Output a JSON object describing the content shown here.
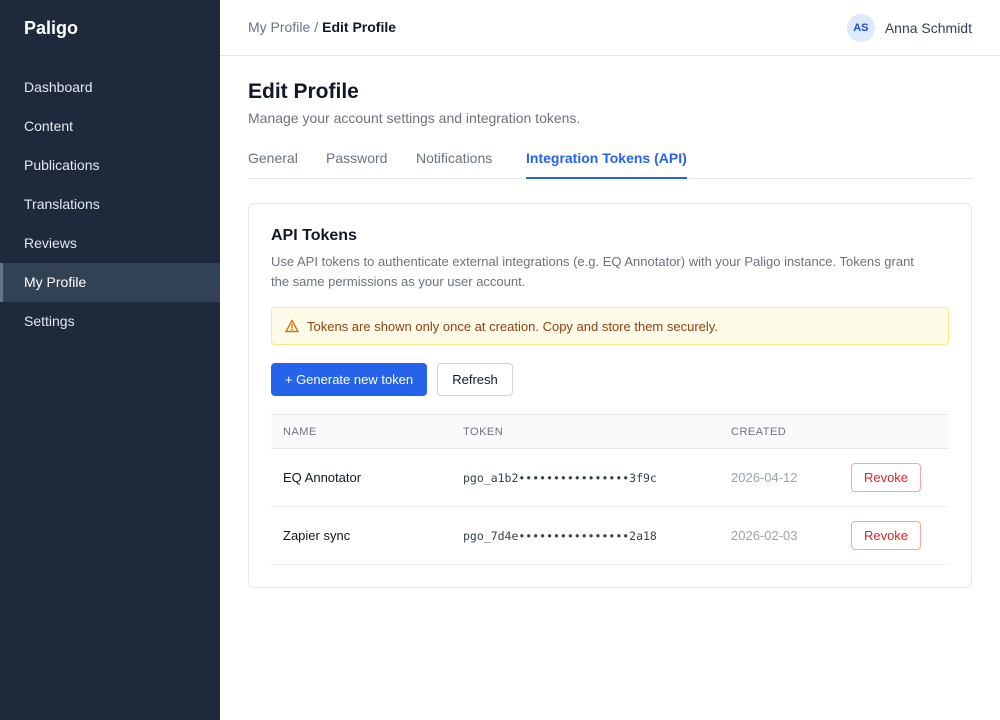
{
  "sidebar": {
    "brand": "Paligo",
    "items": [
      {
        "label": "Dashboard",
        "active": false
      },
      {
        "label": "Content",
        "active": false
      },
      {
        "label": "Publications",
        "active": false
      },
      {
        "label": "Translations",
        "active": false
      },
      {
        "label": "Reviews",
        "active": false
      },
      {
        "label": "My Profile",
        "active": true
      },
      {
        "label": "Settings",
        "active": false
      }
    ]
  },
  "header": {
    "breadcrumb": {
      "parent": "My Profile",
      "separator": "/",
      "current": "Edit Profile"
    },
    "user": {
      "initials": "AS",
      "name": "Anna Schmidt"
    }
  },
  "page": {
    "title": "Edit Profile",
    "subtitle": "Manage your account settings and integration tokens.",
    "tabs": [
      {
        "label": "General",
        "active": false
      },
      {
        "label": "Password",
        "active": false
      },
      {
        "label": "Notifications",
        "active": false
      },
      {
        "label": "Integration Tokens (API)",
        "active": true
      }
    ]
  },
  "card": {
    "title": "API Tokens",
    "description": "Use API tokens to authenticate external integrations (e.g. EQ Annotator) with your Paligo instance. Tokens grant the same permissions as your user account.",
    "alert": {
      "icon": "warning-icon",
      "text": "Tokens are shown only once at creation. Copy and store them securely."
    },
    "generate_label": "+ Generate new token",
    "refresh_label": "Refresh",
    "table": {
      "headers": {
        "name": "NAME",
        "token": "TOKEN",
        "created": "CREATED"
      },
      "rows": [
        {
          "name": "EQ Annotator",
          "token": "pgo_a1b2••••••••••••••••3f9c",
          "created": "2026-04-12",
          "action": "Revoke"
        },
        {
          "name": "Zapier sync",
          "token": "pgo_7d4e••••••••••••••••2a18",
          "created": "2026-02-03",
          "action": "Revoke"
        }
      ]
    }
  },
  "colors": {
    "sidebar_bg": "#1e293b",
    "accent": "#2563eb",
    "danger": "#dc2626",
    "warning_bg": "#fefce8"
  }
}
